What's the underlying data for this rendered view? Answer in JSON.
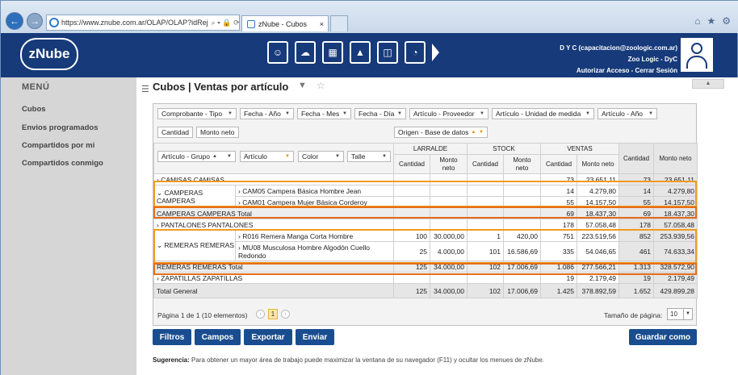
{
  "browser": {
    "url": "https://www.znube.com.ar/OLAP/OLAP?idRej",
    "tab_title": "zNube - Cubos",
    "address_icons": "⌕ ▾ 🔒 ⟳"
  },
  "app": {
    "logo": "zNube",
    "user_line1": "D Y C (capacitacion@zoologic.com.ar)",
    "user_line2": "Zoo Logic - DyC",
    "user_links": "Autorizar Acceso - Cerrar Sesión"
  },
  "sidebar": {
    "title": "MENÚ",
    "items": [
      "Cubos",
      "Envios programados",
      "Compartidos por mi",
      "Compartidos conmigo"
    ]
  },
  "page": {
    "title": "Cubos | Ventas por artículo"
  },
  "filters": [
    "Comprobante - Tipo",
    "Fecha - Año",
    "Fecha - Mes",
    "Fecha - Día",
    "Artículo - Proveedor",
    "Artículo - Unidad de medida",
    "Artículo - Año"
  ],
  "data_fields": [
    "Cantidad",
    "Monto neto"
  ],
  "column_field": "Origen - Base de datos",
  "row_fields": [
    "Artículo - Grupo",
    "Artículo",
    "Color",
    "Talle"
  ],
  "column_groups": [
    "LARRALDE",
    "STOCK",
    "VENTAS"
  ],
  "measures": {
    "qty": "Cantidad",
    "amount": "Monto neto"
  },
  "rows": [
    {
      "g": "CAMISAS CAMISAS",
      "vc": "73",
      "vm": "23.651,11",
      "tc": "73",
      "tm": "23.651,11"
    },
    {
      "g": "CAMPERAS CAMPERAS",
      "a": "CAM05 Campera Básica Hombre Jean",
      "vc": "14",
      "vm": "4.279,80",
      "tc": "14",
      "tm": "4.279,80"
    },
    {
      "a": "CAM01 Campera Mujer Básica Corderoy",
      "vc": "55",
      "vm": "14.157,50",
      "tc": "55",
      "tm": "14.157,50"
    },
    {
      "g": "CAMPERAS CAMPERAS Total",
      "vc": "69",
      "vm": "18.437,30",
      "tc": "69",
      "tm": "18.437,30"
    },
    {
      "g": "PANTALONES PANTALONES",
      "vc": "178",
      "vm": "57.058,48",
      "tc": "178",
      "tm": "57.058,48"
    },
    {
      "g": "REMERAS REMERAS",
      "a": "R016 Remera Manga Corta Hombre",
      "lc": "100",
      "lm": "30.000,00",
      "sc": "1",
      "sm": "420,00",
      "vc": "751",
      "vm": "223.519,56",
      "tc": "852",
      "tm": "253.939,56"
    },
    {
      "a": "MU08 Musculosa Hombre Algodón Cuello Redondo",
      "lc": "25",
      "lm": "4.000,00",
      "sc": "101",
      "sm": "16.586,69",
      "vc": "335",
      "vm": "54.046,65",
      "tc": "461",
      "tm": "74.633,34"
    },
    {
      "g": "REMERAS REMERAS Total",
      "lc": "125",
      "lm": "34.000,00",
      "sc": "102",
      "sm": "17.006,69",
      "vc": "1.086",
      "vm": "277.566,21",
      "tc": "1.313",
      "tm": "328.572,90"
    },
    {
      "g": "ZAPATILLAS ZAPATILLAS",
      "vc": "19",
      "vm": "2.179,49",
      "tc": "19",
      "tm": "2.179,49"
    },
    {
      "g": "Total General",
      "lc": "125",
      "lm": "34.000,00",
      "sc": "102",
      "sm": "17.006,69",
      "vc": "1.425",
      "vm": "378.892,59",
      "tc": "1.652",
      "tm": "429.899,28"
    }
  ],
  "pager": {
    "info": "Página 1 de 1 (10 elementos)",
    "current": "1",
    "size_label": "Tamaño de página:",
    "size": "10"
  },
  "buttons": {
    "filtros": "Filtros",
    "campos": "Campos",
    "exportar": "Exportar",
    "enviar": "Enviar",
    "guardar": "Guardar como"
  },
  "hint": {
    "label": "Sugerencia:",
    "text": "Para obtener un mayor área de trabajo puede maximizar la ventana de su navegador (F11) y ocultar los menues de zNube."
  }
}
